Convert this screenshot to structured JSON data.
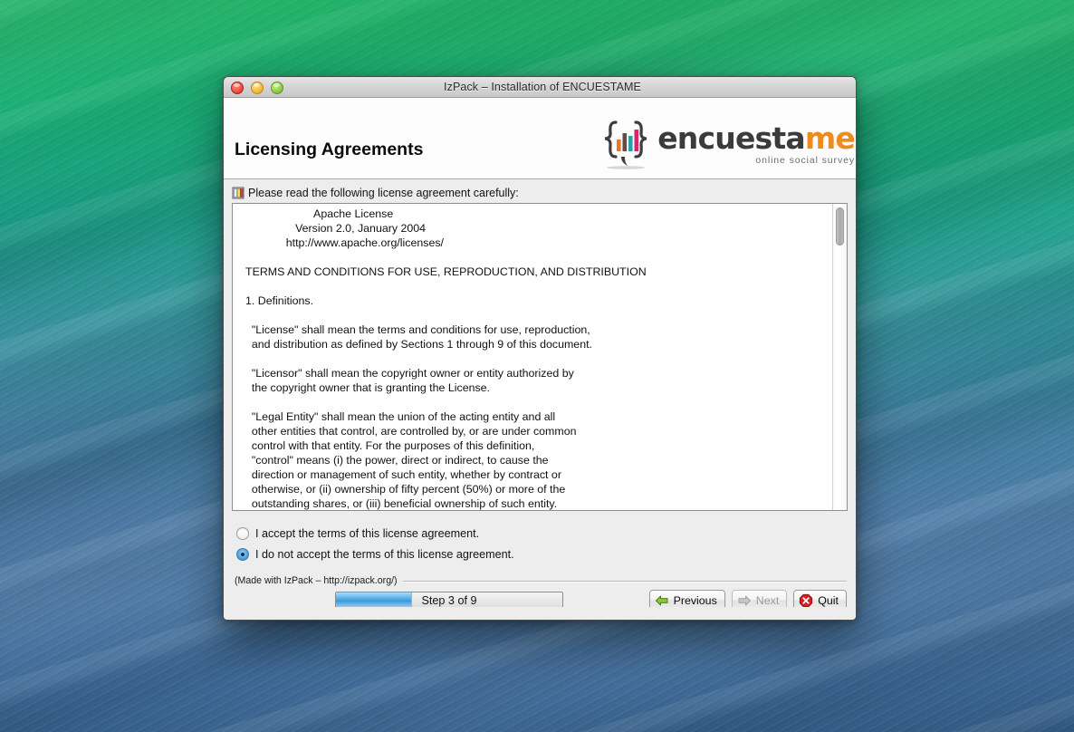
{
  "window": {
    "title": "IzPack – Installation of  ENCUESTAME",
    "traffic_lights": [
      "close-button",
      "minimize-button",
      "zoom-button"
    ]
  },
  "header": {
    "page_title": "Licensing Agreements",
    "logo": {
      "word_part1": "encuesta",
      "word_part2": "me",
      "tagline": "online social survey",
      "mark_colors": [
        "#e8762c",
        "#6b4a44",
        "#2aa1a8",
        "#d6246e"
      ],
      "accent_color": "#f08a1c",
      "dark_color": "#3b3b3b"
    }
  },
  "content": {
    "read_label": "Please read the following license agreement carefully:",
    "license_text": "                      Apache License\n                Version 2.0, January 2004\n             http://www.apache.org/licenses/\n\nTERMS AND CONDITIONS FOR USE, REPRODUCTION, AND DISTRIBUTION\n\n1. Definitions.\n\n  \"License\" shall mean the terms and conditions for use, reproduction,\n  and distribution as defined by Sections 1 through 9 of this document.\n\n  \"Licensor\" shall mean the copyright owner or entity authorized by\n  the copyright owner that is granting the License.\n\n  \"Legal Entity\" shall mean the union of the acting entity and all\n  other entities that control, are controlled by, or are under common\n  control with that entity. For the purposes of this definition,\n  \"control\" means (i) the power, direct or indirect, to cause the\n  direction or management of such entity, whether by contract or\n  otherwise, or (ii) ownership of fifty percent (50%) or more of the\n  outstanding shares, or (iii) beneficial ownership of such entity."
  },
  "choices": {
    "accept": {
      "label": "I accept the terms of this license agreement.",
      "selected": false
    },
    "decline": {
      "label": "I do not accept the terms of this license agreement.",
      "selected": true
    }
  },
  "footer": {
    "made_with": "(Made with IzPack – http://izpack.org/)",
    "progress": {
      "label": "Step 3 of 9",
      "current": 3,
      "total": 9,
      "percent": 33
    },
    "buttons": {
      "previous": {
        "label": "Previous",
        "icon": "arrow-left-icon",
        "enabled": true
      },
      "next": {
        "label": "Next",
        "icon": "arrow-right-icon",
        "enabled": false
      },
      "quit": {
        "label": "Quit",
        "icon": "stop-x-icon",
        "enabled": true
      }
    }
  }
}
